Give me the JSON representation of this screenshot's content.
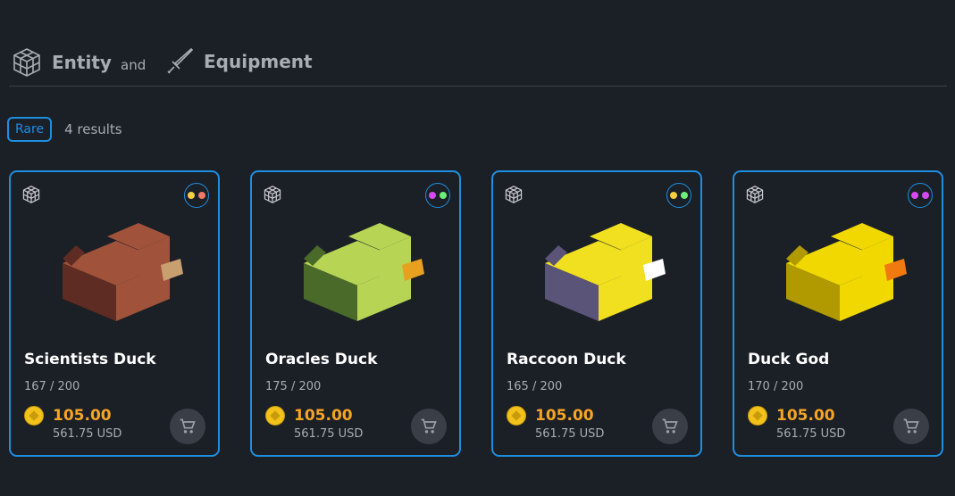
{
  "header": {
    "entity_label": "Entity",
    "and_label": "and",
    "equipment_label": "Equipment",
    "entity_icon": "cube-icon",
    "equipment_icon": "sword-icon"
  },
  "filters": {
    "active_tag": "Rare",
    "results_text": "4 results"
  },
  "colors": {
    "accent": "#1e8fe0",
    "price": "#f5a524",
    "coin": "#f2c21b",
    "background": "#1b1f26"
  },
  "cards": [
    {
      "title": "Scientists Duck",
      "supply": "167 / 200",
      "price": "105.00",
      "usd": "561.75 USD",
      "dot_colors": [
        "#f5d142",
        "#f07a6a"
      ],
      "art_colors": {
        "main": "#a0533a",
        "dark": "#5e2c22",
        "accent": "#c8a070"
      }
    },
    {
      "title": "Oracles Duck",
      "supply": "175 / 200",
      "price": "105.00",
      "usd": "561.75 USD",
      "dot_colors": [
        "#d24bf0",
        "#6cf07a"
      ],
      "art_colors": {
        "main": "#b8d455",
        "dark": "#4a6a2a",
        "accent": "#e8a020"
      }
    },
    {
      "title": "Raccoon Duck",
      "supply": "165 / 200",
      "price": "105.00",
      "usd": "561.75 USD",
      "dot_colors": [
        "#f5d142",
        "#6cf07a"
      ],
      "art_colors": {
        "main": "#f0e020",
        "dark": "#5a5478",
        "accent": "#ffffff"
      }
    },
    {
      "title": "Duck God",
      "supply": "170 / 200",
      "price": "105.00",
      "usd": "561.75 USD",
      "dot_colors": [
        "#d24bf0",
        "#d24bf0"
      ],
      "art_colors": {
        "main": "#f0d800",
        "dark": "#b09a00",
        "accent": "#f07a10"
      }
    }
  ]
}
